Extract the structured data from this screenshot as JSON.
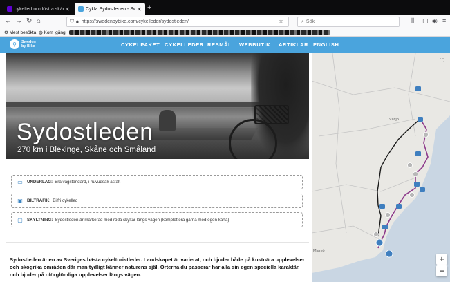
{
  "browser": {
    "tabs": [
      {
        "title": "cykelled nordöstra skåne - Yah",
        "active": false
      },
      {
        "title": "Cykla Sydostleden - Sweden b",
        "active": true
      }
    ],
    "new_tab_label": "+",
    "url": "https://swedenbybike.com/cykelleder/sydostleden/",
    "url_actions": "··· ☆",
    "search_placeholder": "Sök",
    "bookmarks": [
      "Mest besökta",
      "Kom igång"
    ]
  },
  "site": {
    "logo_line1": "Sweden",
    "logo_line2": "by Bike",
    "menu": [
      "CYKELPAKET",
      "CYKELLEDER",
      "RESMÅL",
      "WEBBUTIK",
      "ARTIKLAR",
      "ENGLISH"
    ]
  },
  "hero": {
    "title": "Sydostleden",
    "subtitle": "270 km i Blekinge, Skåne och Småland"
  },
  "info": [
    {
      "icon": "road-icon",
      "label": "UNDERLAG:",
      "text": "Bra vägstandard, i huvudsak asfalt"
    },
    {
      "icon": "car-icon",
      "label": "BILTRAFIK:",
      "text": "Bilfri cykelled"
    },
    {
      "icon": "sign-icon",
      "label": "SKYLTNING:",
      "text": "Sydostleden är markerad med röda skyltar längs vägen (komplettera gärna med egen karta)"
    }
  ],
  "body": "Sydostleden är en av Sveriges bästa cykelturistleder. Landskapet är varierat, och bjuder både på kustnära upplevelser och skogrika områden där man tydligt känner naturens själ. Orterna du passerar har alla sin egen speciella karaktär, och bjuder på oförglömliga upplevelser längs vägen.",
  "map": {
    "labels": [
      "Växjö",
      "Malmö"
    ],
    "zoom_in": "+",
    "zoom_out": "−",
    "fullscreen": "⛶"
  },
  "colors": {
    "brand": "#4aa4dd",
    "route": "#8e3a8b"
  }
}
